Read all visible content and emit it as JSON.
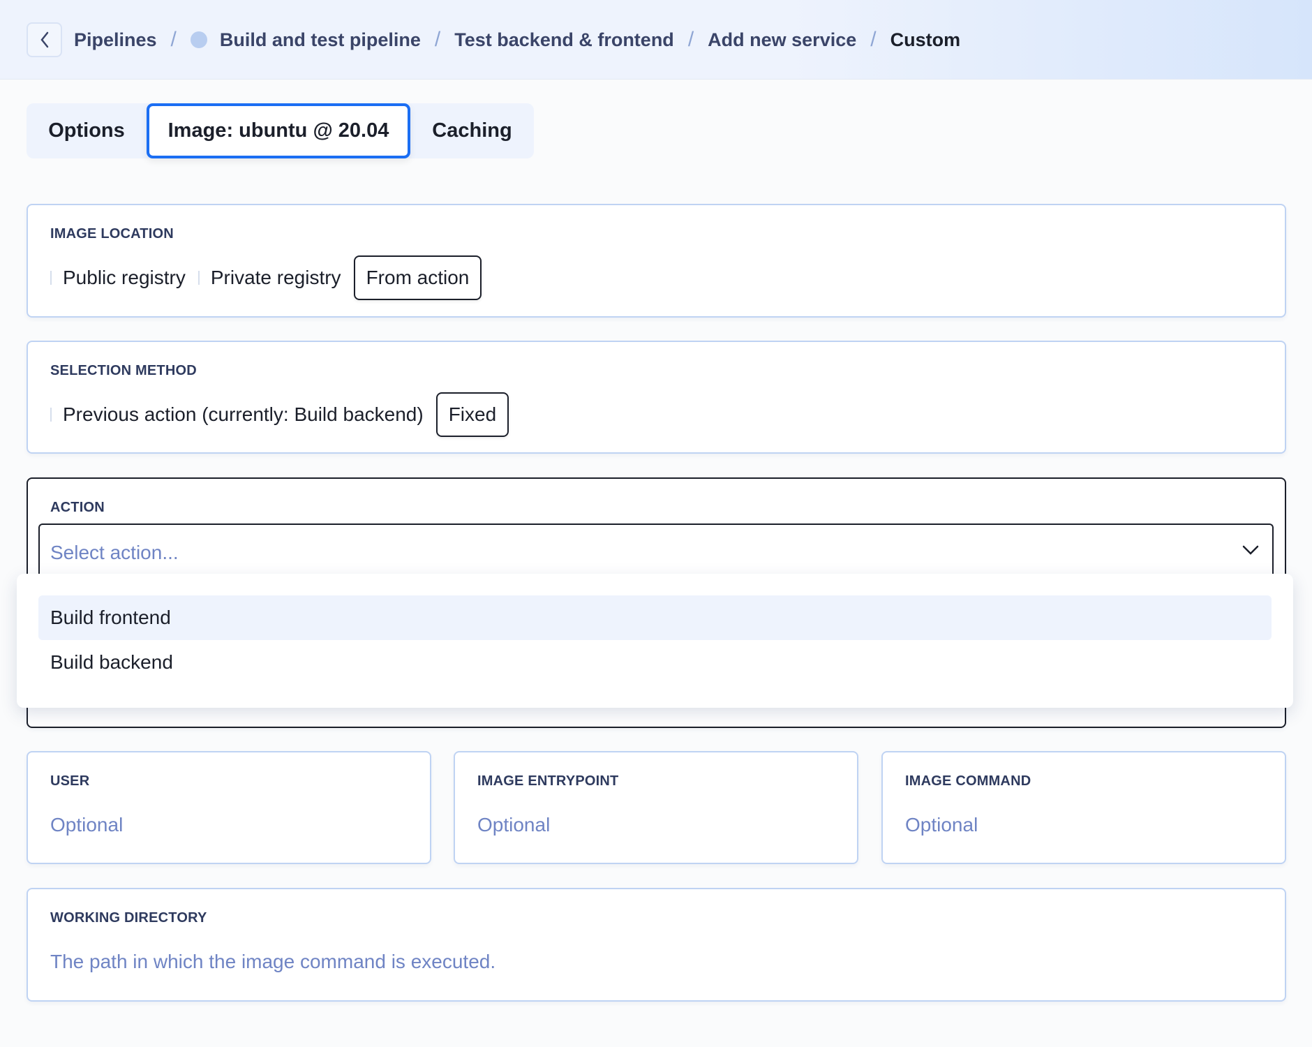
{
  "breadcrumb": {
    "items": [
      "Pipelines",
      "Build and test pipeline",
      "Test backend & frontend",
      "Add new service",
      "Custom"
    ],
    "separator": "/"
  },
  "tabs": [
    {
      "label": "Options"
    },
    {
      "label": "Image: ubuntu @ 20.04",
      "active": true
    },
    {
      "label": "Caching"
    }
  ],
  "image_location": {
    "label": "IMAGE LOCATION",
    "options": [
      "Public registry",
      "Private registry",
      "From action"
    ],
    "selected": "From action"
  },
  "selection_method": {
    "label": "SELECTION METHOD",
    "options": [
      "Previous action (currently: Build backend)",
      "Fixed"
    ],
    "selected": "Fixed"
  },
  "action": {
    "label": "ACTION",
    "placeholder": "Select action...",
    "options": [
      "Build frontend",
      "Build backend"
    ],
    "highlighted": "Build frontend"
  },
  "user": {
    "label": "USER",
    "placeholder": "Optional"
  },
  "entrypoint": {
    "label": "IMAGE ENTRYPOINT",
    "placeholder": "Optional"
  },
  "command": {
    "label": "IMAGE COMMAND",
    "placeholder": "Optional"
  },
  "workdir": {
    "label": "WORKING DIRECTORY",
    "placeholder": "The path in which the image command is executed."
  },
  "colors": {
    "accent": "#1b6ef3",
    "placeholder": "#6f84c4",
    "border": "#bfd3f3"
  }
}
